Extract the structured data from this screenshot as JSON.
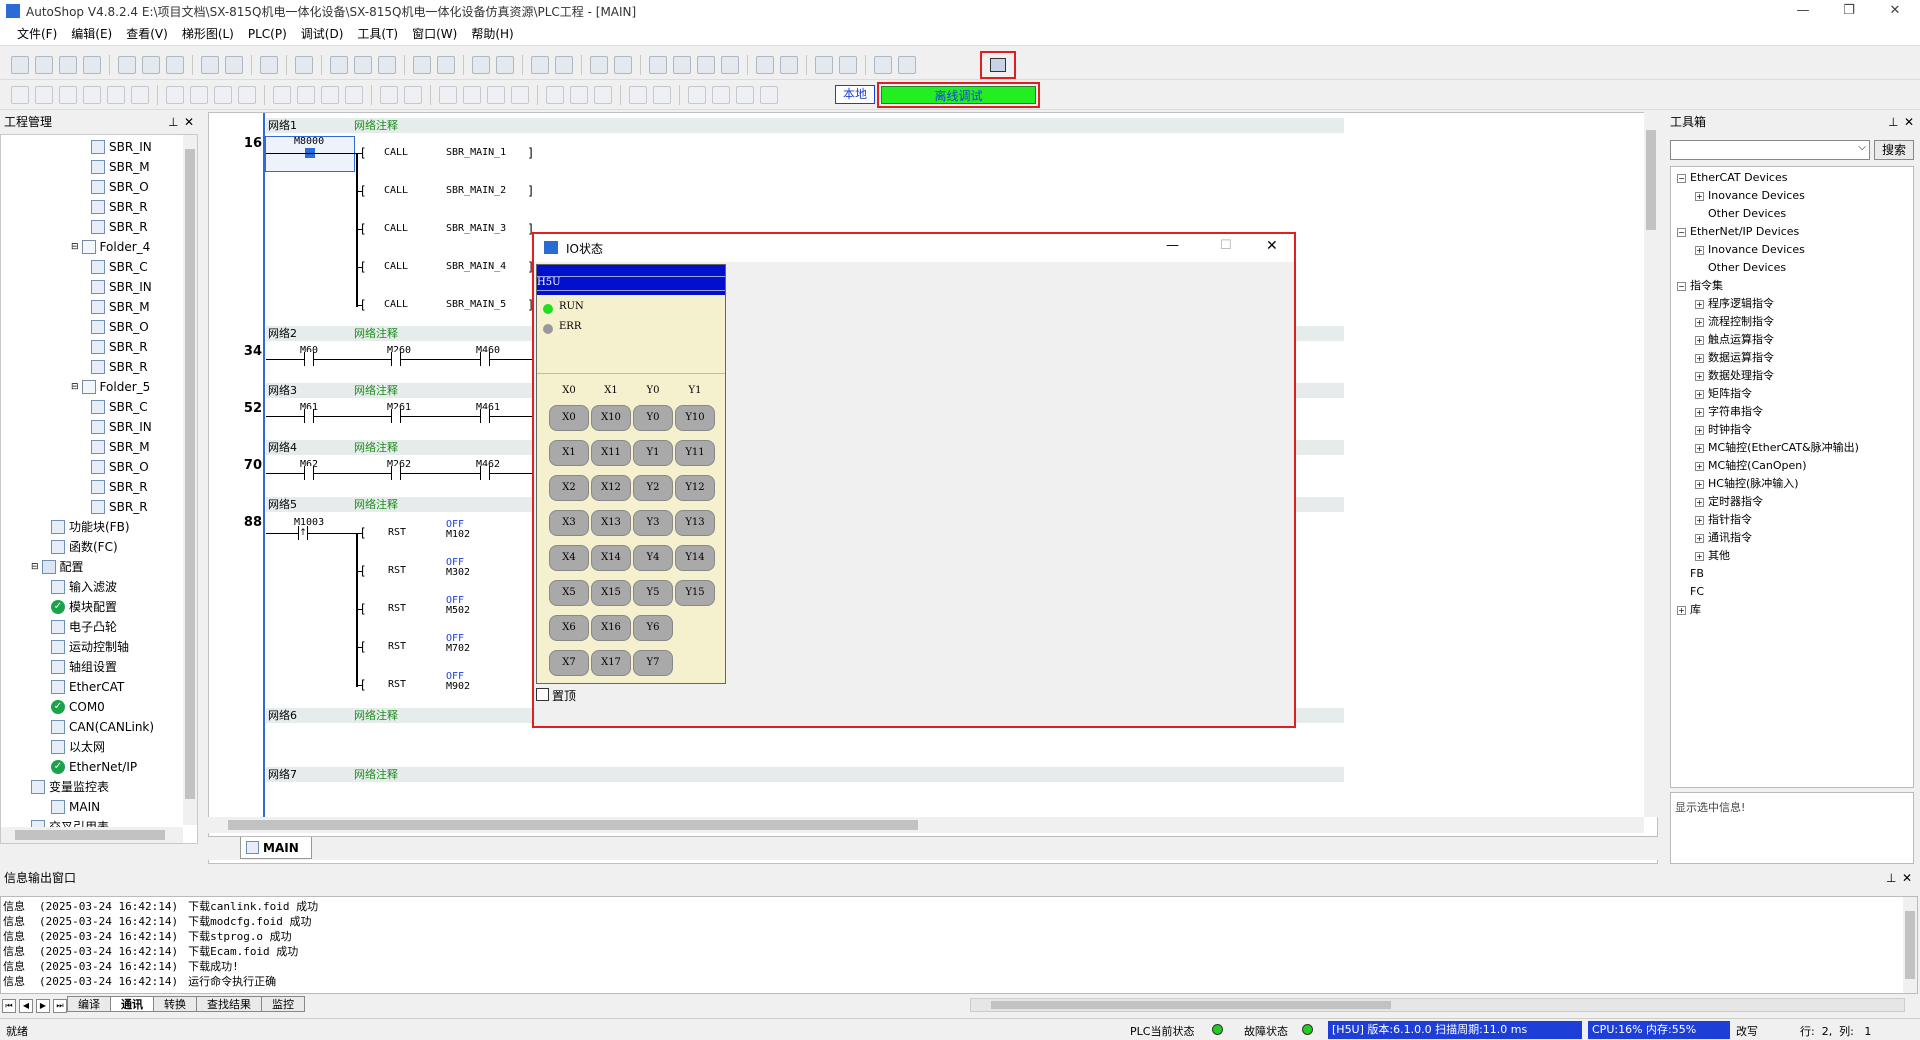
{
  "window": {
    "title": "AutoShop V4.8.2.4  E:\\项目文档\\SX-815Q机电一体化设备\\SX-815Q机电一体化设备仿真资源\\PLC工程 - [MAIN]",
    "min": "—",
    "max": "❐",
    "close": "✕"
  },
  "menu": [
    "文件(F)",
    "编辑(E)",
    "查看(V)",
    "梯形图(L)",
    "PLC(P)",
    "调试(D)",
    "工具(T)",
    "窗口(W)",
    "帮助(H)"
  ],
  "toolbar2": {
    "local_label": "本地",
    "offline_debug_label": "离线调试"
  },
  "project_panel": {
    "title": "工程管理",
    "pin": "ᵖ",
    "close": "✕",
    "items": [
      {
        "indent": 3,
        "icon": "file",
        "label": "SBR_IN"
      },
      {
        "indent": 3,
        "icon": "file",
        "label": "SBR_M"
      },
      {
        "indent": 3,
        "icon": "file",
        "label": "SBR_O"
      },
      {
        "indent": 3,
        "icon": "file",
        "label": "SBR_R"
      },
      {
        "indent": 3,
        "icon": "file",
        "label": "SBR_R"
      },
      {
        "indent": 2,
        "icon": "folder",
        "label": "Folder_4"
      },
      {
        "indent": 3,
        "icon": "file",
        "label": "SBR_C"
      },
      {
        "indent": 3,
        "icon": "file",
        "label": "SBR_IN"
      },
      {
        "indent": 3,
        "icon": "file",
        "label": "SBR_M"
      },
      {
        "indent": 3,
        "icon": "file",
        "label": "SBR_O"
      },
      {
        "indent": 3,
        "icon": "file",
        "label": "SBR_R"
      },
      {
        "indent": 3,
        "icon": "file",
        "label": "SBR_R"
      },
      {
        "indent": 2,
        "icon": "folder",
        "label": "Folder_5"
      },
      {
        "indent": 3,
        "icon": "file",
        "label": "SBR_C"
      },
      {
        "indent": 3,
        "icon": "file",
        "label": "SBR_IN"
      },
      {
        "indent": 3,
        "icon": "file",
        "label": "SBR_M"
      },
      {
        "indent": 3,
        "icon": "file",
        "label": "SBR_O"
      },
      {
        "indent": 3,
        "icon": "file",
        "label": "SBR_R"
      },
      {
        "indent": 3,
        "icon": "file",
        "label": "SBR_R"
      },
      {
        "indent": 1,
        "icon": "list",
        "label": "功能块(FB)"
      },
      {
        "indent": 1,
        "icon": "list",
        "label": "函数(FC)"
      },
      {
        "indent": 0,
        "icon": "cfg",
        "label": "配置"
      },
      {
        "indent": 1,
        "icon": "filter",
        "label": "输入滤波"
      },
      {
        "indent": 1,
        "icon": "check",
        "label": "模块配置"
      },
      {
        "indent": 1,
        "icon": "cam",
        "label": "电子凸轮"
      },
      {
        "indent": 1,
        "icon": "axis",
        "label": "运动控制轴"
      },
      {
        "indent": 1,
        "icon": "gear",
        "label": "轴组设置"
      },
      {
        "indent": 1,
        "icon": "ecat",
        "label": "EtherCAT"
      },
      {
        "indent": 1,
        "icon": "check",
        "label": "COM0"
      },
      {
        "indent": 1,
        "icon": "net",
        "label": "CAN(CANLink)"
      },
      {
        "indent": 1,
        "icon": "net",
        "label": "以太网"
      },
      {
        "indent": 1,
        "icon": "check",
        "label": "EtherNet/IP"
      },
      {
        "indent": 0,
        "icon": "watch",
        "label": "变量监控表"
      },
      {
        "indent": 1,
        "icon": "file",
        "label": "MAIN"
      },
      {
        "indent": 0,
        "icon": "xref",
        "label": "交叉引用表"
      }
    ]
  },
  "editor": {
    "tab": "MAIN",
    "networks": [
      {
        "label": "网络1",
        "comment": "网络注释",
        "step": "16"
      },
      {
        "label": "网络2",
        "comment": "网络注释",
        "step": "34"
      },
      {
        "label": "网络3",
        "comment": "网络注释",
        "step": "52"
      },
      {
        "label": "网络4",
        "comment": "网络注释",
        "step": "70"
      },
      {
        "label": "网络5",
        "comment": "网络注释",
        "step": "88"
      },
      {
        "label": "网络6",
        "comment": "网络注释",
        "step": ""
      },
      {
        "label": "网络7",
        "comment": "网络注释",
        "step": ""
      }
    ],
    "n1_contact": "M8000",
    "calls": [
      {
        "op": "CALL",
        "arg": "SBR_MAIN_1"
      },
      {
        "op": "CALL",
        "arg": "SBR_MAIN_2"
      },
      {
        "op": "CALL",
        "arg": "SBR_MAIN_3"
      },
      {
        "op": "CALL",
        "arg": "SBR_MAIN_4"
      },
      {
        "op": "CALL",
        "arg": "SBR_MAIN_5"
      }
    ],
    "n2_contacts": [
      "M60",
      "M260",
      "M460"
    ],
    "n3_contacts": [
      "M61",
      "M261",
      "M461"
    ],
    "n4_contacts": [
      "M62",
      "M262",
      "M462"
    ],
    "n5_contact": "M1003",
    "rsts": [
      {
        "op": "RST",
        "state": "OFF",
        "arg": "M102"
      },
      {
        "op": "RST",
        "state": "OFF",
        "arg": "M302"
      },
      {
        "op": "RST",
        "state": "OFF",
        "arg": "M502"
      },
      {
        "op": "RST",
        "state": "OFF",
        "arg": "M702"
      },
      {
        "op": "RST",
        "state": "OFF",
        "arg": "M902"
      }
    ]
  },
  "io_dialog": {
    "title": "IO状态",
    "min": "—",
    "max": "☐",
    "close": "✕",
    "model": "H5U",
    "run": "RUN",
    "err": "ERR",
    "topmost": "置顶",
    "columns": [
      "X0",
      "X1",
      "Y0",
      "Y1"
    ],
    "col0": [
      "X0",
      "X1",
      "X2",
      "X3",
      "X4",
      "X5",
      "X6",
      "X7"
    ],
    "col1": [
      "X10",
      "X11",
      "X12",
      "X13",
      "X14",
      "X15",
      "X16",
      "X17"
    ],
    "col2": [
      "Y0",
      "Y1",
      "Y2",
      "Y3",
      "Y4",
      "Y5",
      "Y6",
      "Y7"
    ],
    "col3": [
      "Y10",
      "Y11",
      "Y12",
      "Y13",
      "Y14",
      "Y15"
    ]
  },
  "toolbox": {
    "title": "工具箱",
    "search": "搜索",
    "info": "显示选中信息!",
    "items": [
      {
        "lvl": 0,
        "pm": "−",
        "label": "EtherCAT Devices"
      },
      {
        "lvl": 1,
        "pm": "+",
        "label": "Inovance Devices"
      },
      {
        "lvl": 1,
        "pm": "",
        "label": "Other Devices"
      },
      {
        "lvl": 0,
        "pm": "−",
        "label": "EtherNet/IP Devices"
      },
      {
        "lvl": 1,
        "pm": "+",
        "label": "Inovance Devices"
      },
      {
        "lvl": 1,
        "pm": "",
        "label": "Other Devices"
      },
      {
        "lvl": 0,
        "pm": "−",
        "label": "指令集"
      },
      {
        "lvl": 1,
        "pm": "+",
        "label": "程序逻辑指令"
      },
      {
        "lvl": 1,
        "pm": "+",
        "label": "流程控制指令"
      },
      {
        "lvl": 1,
        "pm": "+",
        "label": "触点运算指令"
      },
      {
        "lvl": 1,
        "pm": "+",
        "label": "数据运算指令"
      },
      {
        "lvl": 1,
        "pm": "+",
        "label": "数据处理指令"
      },
      {
        "lvl": 1,
        "pm": "+",
        "label": "矩阵指令"
      },
      {
        "lvl": 1,
        "pm": "+",
        "label": "字符串指令"
      },
      {
        "lvl": 1,
        "pm": "+",
        "label": "时钟指令"
      },
      {
        "lvl": 1,
        "pm": "+",
        "label": "MC轴控(EtherCAT&脉冲输出)"
      },
      {
        "lvl": 1,
        "pm": "+",
        "label": "MC轴控(CanOpen)"
      },
      {
        "lvl": 1,
        "pm": "+",
        "label": "HC轴控(脉冲输入)"
      },
      {
        "lvl": 1,
        "pm": "+",
        "label": "定时器指令"
      },
      {
        "lvl": 1,
        "pm": "+",
        "label": "指针指令"
      },
      {
        "lvl": 1,
        "pm": "+",
        "label": "通讯指令"
      },
      {
        "lvl": 1,
        "pm": "+",
        "label": "其他"
      },
      {
        "lvl": 0,
        "pm": "",
        "label": "FB"
      },
      {
        "lvl": 0,
        "pm": "",
        "label": "FC"
      },
      {
        "lvl": 0,
        "pm": "+",
        "label": "库"
      }
    ]
  },
  "output": {
    "title": "信息输出窗口",
    "lines": [
      {
        "type": "信息",
        "time": "(2025-03-24 16:42:14)",
        "text": "下载canlink.foid 成功"
      },
      {
        "type": "信息",
        "time": "(2025-03-24 16:42:14)",
        "text": "下载modcfg.foid 成功"
      },
      {
        "type": "信息",
        "time": "(2025-03-24 16:42:14)",
        "text": "下载stprog.o 成功"
      },
      {
        "type": "信息",
        "time": "(2025-03-24 16:42:14)",
        "text": "下载Ecam.foid 成功"
      },
      {
        "type": "信息",
        "time": "(2025-03-24 16:42:14)",
        "text": "下载成功!"
      },
      {
        "type": "信息",
        "time": "(2025-03-24 16:42:14)",
        "text": "运行命令执行正确"
      }
    ],
    "tabs": [
      "编译",
      "通讯",
      "转换",
      "查找结果",
      "监控"
    ]
  },
  "status": {
    "ready": "就绪",
    "plc_state": "PLC当前状态",
    "fault_state": "故障状态",
    "version": "[H5U] 版本:6.1.0.0 扫描周期:11.0 ms",
    "cpu": "CPU:16%  内存:55%",
    "mode": "改写",
    "pos": "行:  2,  列:   1"
  },
  "colors": {
    "accent_red": "#e02020",
    "offline_green": "#22ee22",
    "status_blue": "#1d3fd8",
    "net_comment": "#1c8c1c"
  }
}
